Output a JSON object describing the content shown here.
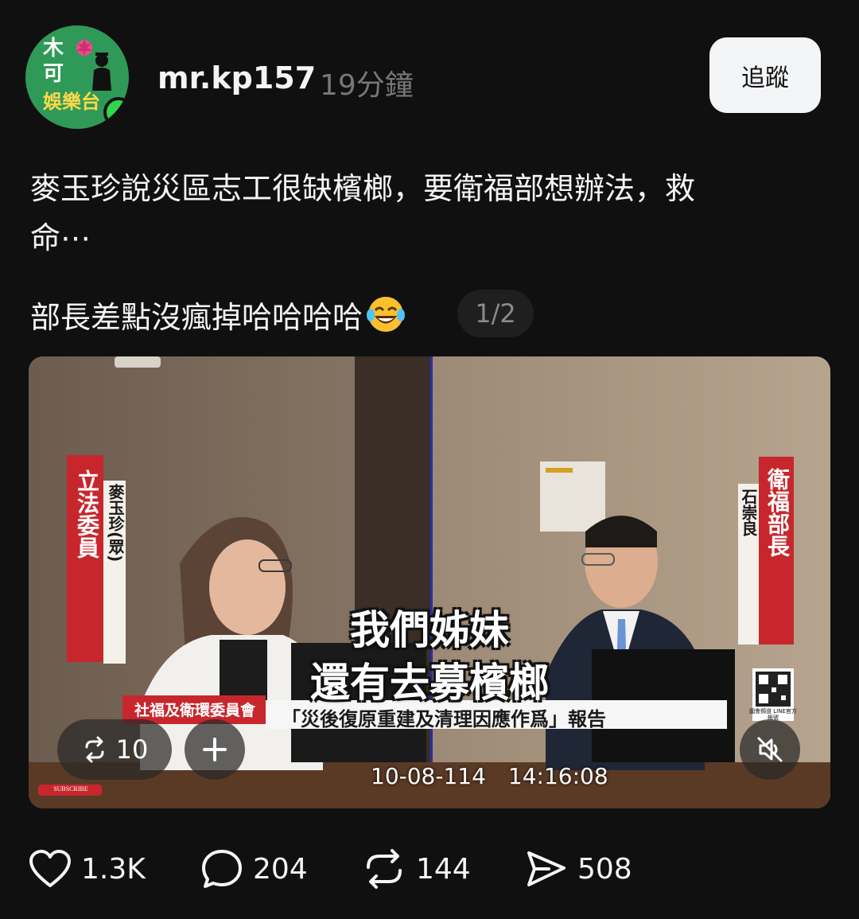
{
  "author": {
    "username": "mr.kp157",
    "time": "19分鐘",
    "avatar_logo": [
      "木",
      "可",
      "娛樂台"
    ],
    "online": true
  },
  "follow_button": {
    "label": "追蹤"
  },
  "post": {
    "line1": "麥玉珍說災區志工很缺檳榔，要衛福部想辦法，救",
    "line2": "命⋯",
    "line3": "部長差點沒瘋掉哈哈哈哈",
    "emoji": "face-with-tears-of-joy",
    "media_counter": "1/2"
  },
  "video": {
    "left_banner": "立法委員",
    "left_name": "麥玉珍(眾)",
    "right_banner": "衛福部長",
    "right_name": "石崇良",
    "subtitle_line1": "我們姊妹",
    "subtitle_line2": "還有去募檳榔",
    "committee": "社福及衛環委員會",
    "report_title": "「災後復原重建及清理因應作爲」報告",
    "timestamp": "10-08-114　14:16:08",
    "subscribe_badge": "SUBSCRIBE",
    "qr_caption": "國會頻道 LINE官方帳號"
  },
  "video_controls": {
    "repost_count": "10",
    "add_icon": "plus-icon",
    "mute_icon": "muted-speaker-icon"
  },
  "actions": {
    "likes": "1.3K",
    "comments": "204",
    "reposts": "144",
    "shares": "508"
  },
  "colors": {
    "background": "#101010",
    "text": "#f3f5f7",
    "muted": "#777777",
    "banner_red": "#c8262d",
    "avatar_green": "#2f9a57",
    "online_dot": "#2ed64a"
  }
}
